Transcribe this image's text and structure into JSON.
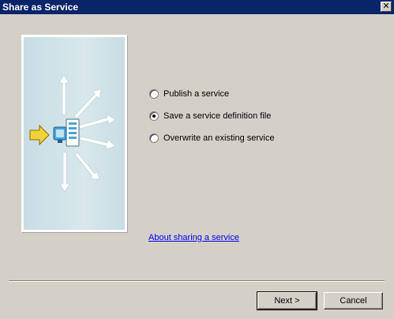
{
  "window": {
    "title": "Share as Service",
    "close_glyph": "✕"
  },
  "illustration": {
    "icon": "server-share-arrows-icon"
  },
  "options": [
    {
      "label": "Publish a service",
      "selected": false
    },
    {
      "label": "Save a service definition file",
      "selected": true
    },
    {
      "label": "Overwrite an existing service",
      "selected": false
    }
  ],
  "link": {
    "text": "About sharing a service"
  },
  "buttons": {
    "next": "Next >",
    "cancel": "Cancel"
  },
  "colors": {
    "titlebar": "#0a246a",
    "dialog_bg": "#d4d0c8",
    "link": "#0000ee",
    "arrow_yellow": "#f2d23a",
    "server_blue": "#4aa3d6"
  }
}
